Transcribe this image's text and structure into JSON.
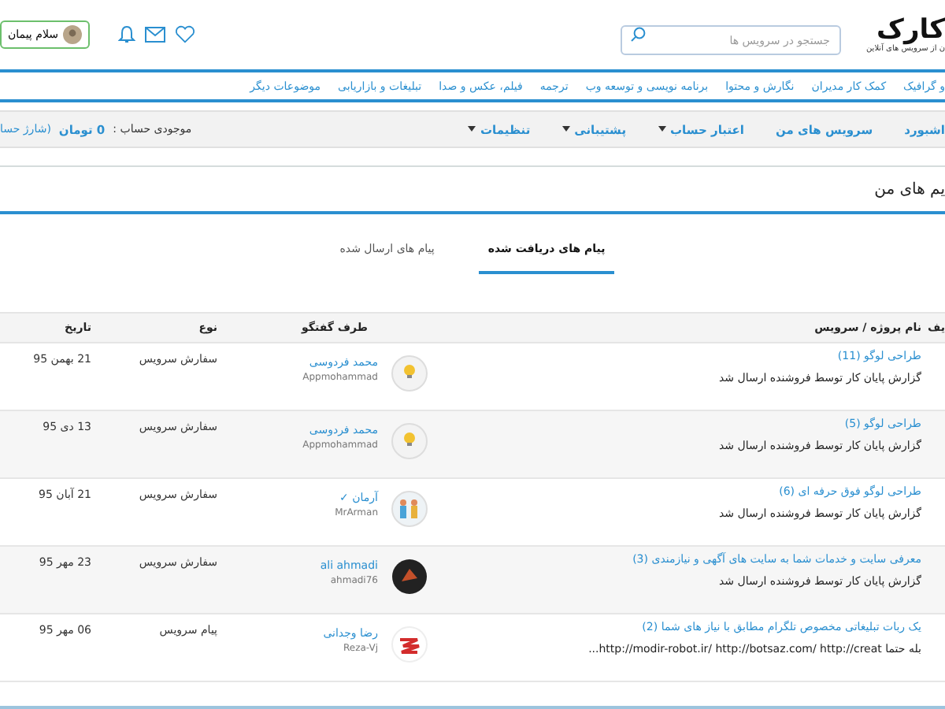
{
  "header": {
    "logo": "کارک",
    "tagline": "ن از سرویس های آنلاین",
    "search": {
      "placeholder": "جستجو در سرویس ها"
    },
    "user_button": "سلام پیمان"
  },
  "categories": [
    "و گرافیک",
    "کمک کار مدیران",
    "نگارش و محتوا",
    "برنامه نویسی و توسعه وب",
    "ترجمه",
    "فیلم، عکس و صدا",
    "تبلیغات و بازاریابی",
    "موضوعات دیگر"
  ],
  "account_menu": [
    {
      "label": "اشبورد",
      "has_menu": false
    },
    {
      "label": "سرویس های من",
      "has_menu": false
    },
    {
      "label": "اعتبار حساب",
      "has_menu": true
    },
    {
      "label": "پشتیبانی",
      "has_menu": true
    },
    {
      "label": "تنظیمات",
      "has_menu": true
    }
  ],
  "balance": {
    "label": "موجودی حساب :",
    "amount": "0 تومان",
    "charge_link": "(شارژ حسا"
  },
  "page_title": "یم های من",
  "tabs": [
    {
      "label": "پیام های دریافت شده",
      "selected": true
    },
    {
      "label": "پیام های ارسال شده",
      "selected": false
    }
  ],
  "table": {
    "columns": [
      "یف",
      "نام پروژه / سرویس",
      "طرف گفتگو",
      "نوع",
      "تاریخ"
    ],
    "rows": [
      {
        "project": "طراحی لوگو (11)",
        "message": "گزارش پایان کار توسط فروشنده ارسال شد",
        "name": "محمد فردوسی",
        "username": "Appmohammad",
        "kind": "bulb",
        "type": "سفارش سرویس",
        "date": "21 بهمن 95"
      },
      {
        "project": "طراحی لوگو (5)",
        "message": "گزارش پایان کار توسط فروشنده ارسال شد",
        "name": "محمد فردوسی",
        "username": "Appmohammad",
        "kind": "bulb",
        "type": "سفارش سرویس",
        "date": "13 دی 95"
      },
      {
        "project": "طراحی لوگو فوق حرفه ای (6)",
        "message": "گزارش پایان کار توسط فروشنده ارسال شد",
        "name": "آرمان ✓",
        "username": "MrArman",
        "kind": "people",
        "type": "سفارش سرویس",
        "date": "21 آبان 95"
      },
      {
        "project": "معرفی سایت و خدمات شما به سایت های آگهی و نیازمندی (3)",
        "message": "گزارش پایان کار توسط فروشنده ارسال شد",
        "name": "ali ahmadi",
        "username": "ahmadi76",
        "kind": "dark",
        "type": "سفارش سرویس",
        "date": "23 مهر 95"
      },
      {
        "project": "یک ربات تبلیغاتی مخصوص تلگرام مطابق با نیاز های شما (2)",
        "message": "بله حتما http://modir-robot.ir/ http://botsaz.com/ http://creat...",
        "name": "رضا وجدانی",
        "username": "Reza-Vj",
        "kind": "logo",
        "type": "پیام سرویس",
        "date": "06 مهر 95"
      }
    ]
  }
}
